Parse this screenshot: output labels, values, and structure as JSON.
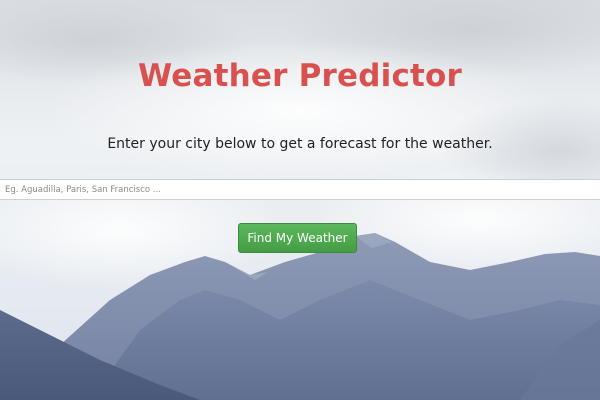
{
  "header": {
    "title": "Weather Predictor",
    "subtitle": "Enter your city below to get a forecast for the weather."
  },
  "search": {
    "placeholder": "Eg. Aguadilla, Paris, San Francisco ...",
    "value": ""
  },
  "actions": {
    "find_label": "Find My Weather"
  },
  "theme": {
    "title_color": "#d9514e",
    "button_color": "#5cb85c",
    "sky_color": "#dfe5ec",
    "mountain_color": "#6f7ea1"
  }
}
